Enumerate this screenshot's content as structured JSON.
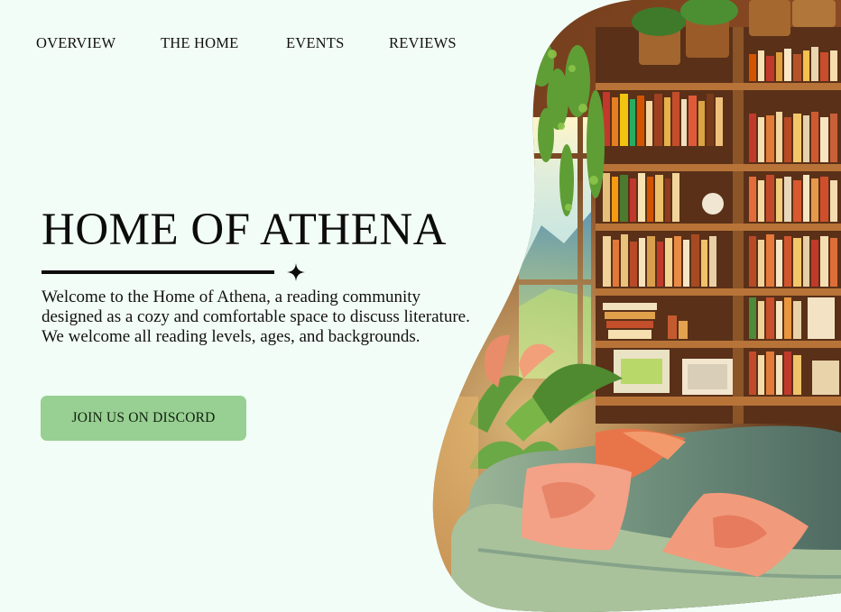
{
  "nav": {
    "items": [
      {
        "label": "OVERVIEW"
      },
      {
        "label": "THE HOME"
      },
      {
        "label": "EVENTS"
      },
      {
        "label": "REVIEWS"
      }
    ]
  },
  "hero": {
    "title": "HOME OF ATHENA",
    "description": "Welcome to the Home of Athena, a reading community designed as a cozy and comfortable space to discuss literature. We welcome all reading levels, ages, and backgrounds.",
    "cta_label": "JOIN US ON DISCORD",
    "divider_icon": "four-point-star-icon"
  },
  "illustration": {
    "subject": "cozy-library-room-illustration"
  },
  "colors": {
    "background": "#f3fdf7",
    "cta_background": "#98cf92",
    "text": "#111111"
  }
}
